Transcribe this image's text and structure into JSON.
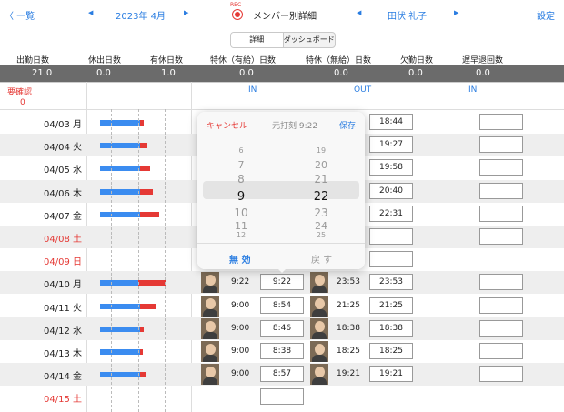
{
  "topbar": {
    "back_label": "一覧",
    "month": "2023年 4月",
    "rec": "REC",
    "title": "メンバー別詳細",
    "member": "田伏 礼子",
    "settings": "設定"
  },
  "tabs": {
    "detail": "詳細",
    "dashboard": "ダッシュボード"
  },
  "stats": {
    "headers": [
      "出勤日数",
      "休出日数",
      "有休日数",
      "特休（有給）日数",
      "特休（無給）日数",
      "欠勤日数",
      "遅早退回数"
    ],
    "values": [
      "21.0",
      "0.0",
      "1.0",
      "0.0",
      "0.0",
      "0.0",
      "0.0"
    ]
  },
  "section": {
    "confirm_label": "要確認",
    "confirm_count": "0",
    "in1": "IN",
    "out": "OUT",
    "in2": "IN"
  },
  "rows": [
    {
      "date": "04/03 月",
      "red": false,
      "in_time": "",
      "in_box": "",
      "out_time": "",
      "out_box": "18:44",
      "blue": 0.58,
      "redbar": 0.05
    },
    {
      "date": "04/04 火",
      "red": false,
      "in_time": "",
      "in_box": "",
      "out_time": "",
      "out_box": "19:27",
      "blue": 0.58,
      "redbar": 0.1
    },
    {
      "date": "04/05 水",
      "red": false,
      "in_time": "",
      "in_box": "",
      "out_time": "",
      "out_box": "19:58",
      "blue": 0.58,
      "redbar": 0.14
    },
    {
      "date": "04/06 木",
      "red": false,
      "in_time": "",
      "in_box": "",
      "out_time": "",
      "out_box": "20:40",
      "blue": 0.58,
      "redbar": 0.18
    },
    {
      "date": "04/07 金",
      "red": false,
      "in_time": "",
      "in_box": "",
      "out_time": "",
      "out_box": "22:31",
      "blue": 0.58,
      "redbar": 0.28
    },
    {
      "date": "04/08 土",
      "red": true,
      "in_time": "",
      "in_box": "",
      "out_time": "",
      "out_box": "",
      "blue": 0,
      "redbar": 0
    },
    {
      "date": "04/09 日",
      "red": true,
      "in_time": "",
      "in_box": "",
      "out_time": "",
      "out_box": "",
      "blue": 0,
      "redbar": 0
    },
    {
      "date": "04/10 月",
      "red": false,
      "in_time": "9:22",
      "in_box": "9:22",
      "out_time": "23:53",
      "out_box": "23:53",
      "blue": 0.56,
      "redbar": 0.4
    },
    {
      "date": "04/11 火",
      "red": false,
      "in_time": "9:00",
      "in_box": "8:54",
      "out_time": "21:25",
      "out_box": "21:25",
      "blue": 0.58,
      "redbar": 0.22
    },
    {
      "date": "04/12 水",
      "red": false,
      "in_time": "9:00",
      "in_box": "8:46",
      "out_time": "18:38",
      "out_box": "18:38",
      "blue": 0.58,
      "redbar": 0.05
    },
    {
      "date": "04/13 木",
      "red": false,
      "in_time": "9:00",
      "in_box": "8:38",
      "out_time": "18:25",
      "out_box": "18:25",
      "blue": 0.58,
      "redbar": 0.04
    },
    {
      "date": "04/14 金",
      "red": false,
      "in_time": "9:00",
      "in_box": "8:57",
      "out_time": "19:21",
      "out_box": "19:21",
      "blue": 0.58,
      "redbar": 0.08
    },
    {
      "date": "04/15 土",
      "red": true,
      "in_time": "",
      "in_box": "",
      "out_time": "",
      "out_box": "",
      "blue": 0,
      "redbar": 0
    }
  ],
  "popup": {
    "cancel": "キャンセル",
    "original": "元打刻 9:22",
    "save": "保存",
    "hours": [
      "6",
      "7",
      "8",
      "9",
      "10",
      "11",
      "12"
    ],
    "minutes": [
      "19",
      "20",
      "21",
      "22",
      "23",
      "24",
      "25"
    ],
    "invalidate": "無 効",
    "restore": "戻 す"
  },
  "colors": {
    "accent": "#2a7de1",
    "red": "#e53935",
    "bar_blue": "#3b8cf0",
    "bar_red": "#e53935",
    "stats_bg": "#6b6b6b"
  }
}
